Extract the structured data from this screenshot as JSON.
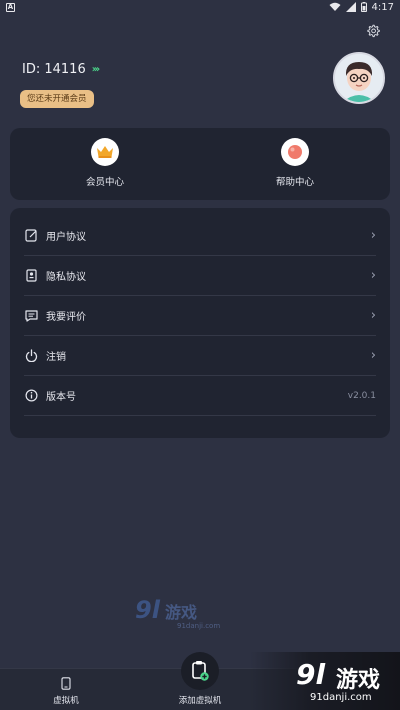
{
  "status_bar": {
    "app_letter": "A",
    "time": "4:17"
  },
  "user": {
    "id_text": "ID: 14116",
    "vip_badge": "您还未开通会员"
  },
  "quick": [
    {
      "label": "会员中心",
      "icon": "crown-icon"
    },
    {
      "label": "帮助中心",
      "icon": "help-ball-icon"
    }
  ],
  "menu": [
    {
      "label": "用户协议",
      "icon": "edit-doc-icon"
    },
    {
      "label": "隐私协议",
      "icon": "privacy-doc-icon"
    },
    {
      "label": "我要评价",
      "icon": "comment-icon"
    },
    {
      "label": "注销",
      "icon": "power-icon"
    },
    {
      "label": "版本号",
      "icon": "info-icon",
      "value": "v2.0.1"
    }
  ],
  "bottom_nav": {
    "vm_label": "虚拟机",
    "add_label": "添加虚拟机"
  },
  "watermark": {
    "big": "9l",
    "zh": "游戏",
    "sub": "91danji.com"
  },
  "colors": {
    "background": "#2d3142",
    "card": "#202431",
    "vip_gold": "#e9bf86",
    "accent_green": "#4bd48a"
  }
}
